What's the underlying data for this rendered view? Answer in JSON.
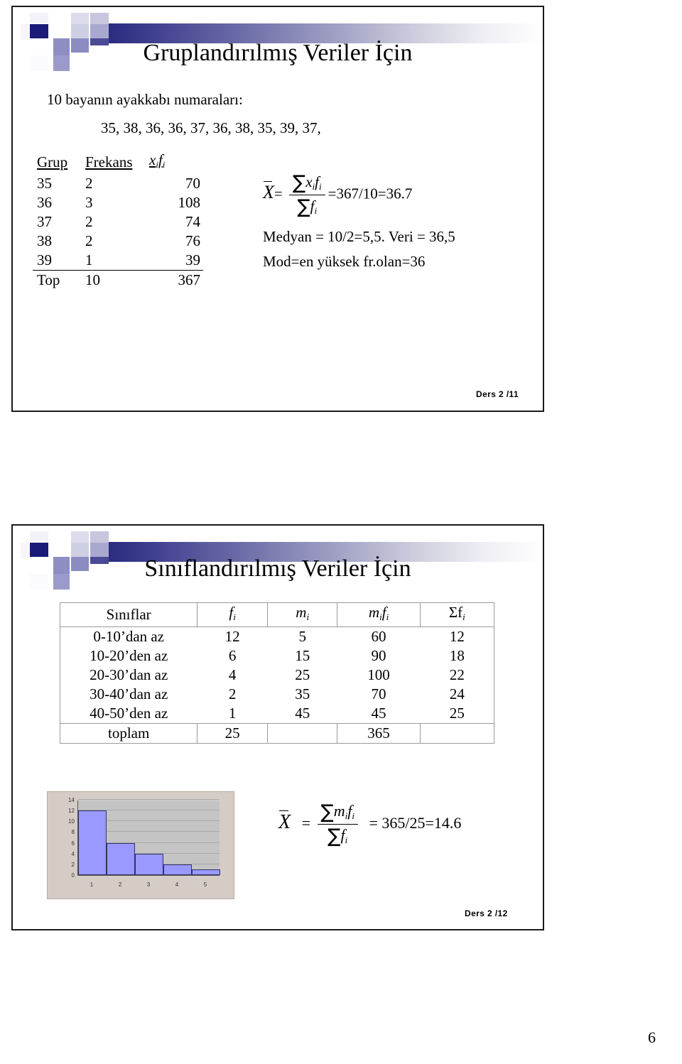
{
  "document": {
    "page_number": "6"
  },
  "slide1": {
    "title": "Gruplandırılmış Veriler İçin",
    "lead": "10 bayanın ayakkabı numaraları:",
    "values": "35, 38, 36, 36, 37, 36, 38, 35, 39, 37,",
    "table": {
      "headers": [
        "Grup",
        "Frekans",
        "xifi"
      ],
      "header_grup": "Grup",
      "header_frekans": "Frekans",
      "header_xf_x": "x",
      "header_xf_f": "f",
      "header_sub": "i",
      "rows": [
        {
          "grup": "35",
          "frekans": "2",
          "xf": "70"
        },
        {
          "grup": "36",
          "frekans": "3",
          "xf": "108"
        },
        {
          "grup": "37",
          "frekans": "2",
          "xf": "74"
        },
        {
          "grup": "38",
          "frekans": "2",
          "xf": "76"
        },
        {
          "grup": "39",
          "frekans": "1",
          "xf": "39"
        }
      ],
      "total": {
        "grup": "Top",
        "frekans": "10",
        "xf": "367"
      }
    },
    "math": {
      "xbar": "X",
      "equals": "=",
      "sigma": "∑",
      "num_x": "x",
      "num_f": "f",
      "den_f": "f",
      "sub_i": "i",
      "result": "=367/10=36.7",
      "medyan_line": "Medyan = 10/2=5,5. Veri = 36,5",
      "mod_line": "Mod=en yüksek fr.olan=36"
    },
    "footer": "Ders 2 /11"
  },
  "slide2": {
    "title": "Sınıflandırılmış Veriler İçin",
    "table": {
      "headers": [
        "Sınıflar",
        "fi",
        "mi",
        "mifi",
        "Σfi"
      ],
      "header_siniflar": "Sınıflar",
      "header_f": "f",
      "header_m": "m",
      "header_mf_m": "m",
      "header_mf_f": "f",
      "header_sigmaf": "Σf",
      "header_sub": "i",
      "rows": [
        {
          "sinif": "0-10’dan az",
          "f": "12",
          "m": "5",
          "mf": "60",
          "cum": "12"
        },
        {
          "sinif": "10-20’den az",
          "f": "6",
          "m": "15",
          "mf": "90",
          "cum": "18"
        },
        {
          "sinif": "20-30’dan az",
          "f": "4",
          "m": "25",
          "mf": "100",
          "cum": "22"
        },
        {
          "sinif": "30-40’dan az",
          "f": "2",
          "m": "35",
          "mf": "70",
          "cum": "24"
        },
        {
          "sinif": "40-50’den az",
          "f": "1",
          "m": "45",
          "mf": "45",
          "cum": "25"
        }
      ],
      "total": {
        "sinif": "toplam",
        "f": "25",
        "m": "",
        "mf": "365",
        "cum": ""
      }
    },
    "math": {
      "xbar": "X",
      "equals": "=",
      "sigma": "∑",
      "num_m": "m",
      "num_f": "f",
      "den_f": "f",
      "sub_i": "i",
      "result": "= 365/25=14.6"
    },
    "footer": "Ders 2 /12"
  },
  "chart_data": {
    "type": "bar",
    "title": "",
    "categories": [
      "1",
      "2",
      "3",
      "4",
      "5"
    ],
    "values": [
      12,
      6,
      4,
      2,
      1
    ],
    "xlabel": "",
    "ylabel": "",
    "ylim": [
      0,
      14
    ],
    "yticks": [
      "14",
      "12",
      "10",
      "8",
      "6",
      "4",
      "2",
      "0"
    ],
    "grid": true,
    "legend": "none",
    "bar_color": "#9999ff",
    "bar_border_color": "#333366",
    "plot_bg": "#c4c4c4",
    "chart_bg": "#d6ccc6"
  }
}
